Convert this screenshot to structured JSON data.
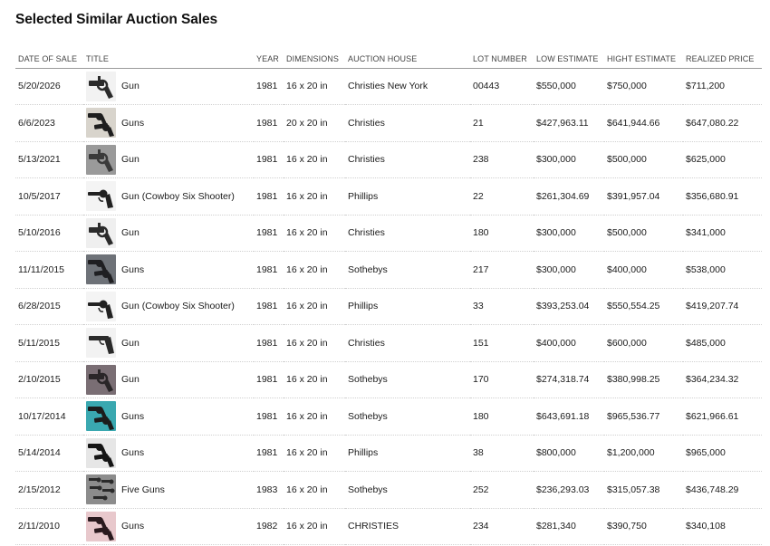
{
  "page": {
    "title": "Selected Similar Auction Sales"
  },
  "columns": {
    "date": "DATE OF SALE",
    "title": "TITLE",
    "year": "YEAR",
    "dimensions": "DIMENSIONS",
    "house": "AUCTION HOUSE",
    "lot": "LOT NUMBER",
    "low": "LOW ESTIMATE",
    "high": "HIGHT ESTIMATE",
    "realized": "REALIZED PRICE"
  },
  "rows": [
    {
      "date": "5/20/2026",
      "title": "Gun",
      "year": "1981",
      "dimensions": "16 x 20 in",
      "house": "Christies New York",
      "lot": "00443",
      "low": "$550,000",
      "high": "$750,000",
      "realized": "$711,200",
      "thumb": {
        "bg": "#f2f2f2",
        "fg": "#2b2b2b",
        "icon": "revolver-thumbnail-icon"
      }
    },
    {
      "date": "6/6/2023",
      "title": "Guns",
      "year": "1981",
      "dimensions": "20 x 20 in",
      "house": "Christies",
      "lot": "21",
      "low": "$427,963.11",
      "high": "$641,944.66",
      "realized": "$647,080.22",
      "thumb": {
        "bg": "#d8d4cc",
        "fg": "#1e1e1e",
        "icon": "revolvers-thumbnail-icon"
      }
    },
    {
      "date": "5/13/2021",
      "title": "Gun",
      "year": "1981",
      "dimensions": "16 x 20 in",
      "house": "Christies",
      "lot": "238",
      "low": "$300,000",
      "high": "$500,000",
      "realized": "$625,000",
      "thumb": {
        "bg": "#9a9a9a",
        "fg": "#3a3a3a",
        "icon": "revolver-thumbnail-icon"
      }
    },
    {
      "date": "10/5/2017",
      "title": "Gun (Cowboy Six Shooter)",
      "year": "1981",
      "dimensions": "16 x 20 in",
      "house": "Phillips",
      "lot": "22",
      "low": "$261,304.69",
      "high": "$391,957.04",
      "realized": "$356,680.91",
      "thumb": {
        "bg": "#f4f4f4",
        "fg": "#222222",
        "icon": "six-shooter-thumbnail-icon"
      }
    },
    {
      "date": "5/10/2016",
      "title": "Gun",
      "year": "1981",
      "dimensions": "16 x 20 in",
      "house": "Christies",
      "lot": "180",
      "low": "$300,000",
      "high": "$500,000",
      "realized": "$341,000",
      "thumb": {
        "bg": "#efefef",
        "fg": "#2a2a2a",
        "icon": "revolver-thumbnail-icon"
      }
    },
    {
      "date": "11/11/2015",
      "title": "Guns",
      "year": "1981",
      "dimensions": "16 x 20 in",
      "house": "Sothebys",
      "lot": "217",
      "low": "$300,000",
      "high": "$400,000",
      "realized": "$538,000",
      "thumb": {
        "bg": "#6e7278",
        "fg": "#1f1f22",
        "icon": "revolvers-thumbnail-icon"
      }
    },
    {
      "date": "6/28/2015",
      "title": "Gun (Cowboy Six Shooter)",
      "year": "1981",
      "dimensions": "16 x 20 in",
      "house": "Phillips",
      "lot": "33",
      "low": "$393,253.04",
      "high": "$550,554.25",
      "realized": "$419,207.74",
      "thumb": {
        "bg": "#f4f4f4",
        "fg": "#222222",
        "icon": "six-shooter-thumbnail-icon"
      }
    },
    {
      "date": "5/11/2015",
      "title": "Gun",
      "year": "1981",
      "dimensions": "16 x 20 in",
      "house": "Christies",
      "lot": "151",
      "low": "$400,000",
      "high": "$600,000",
      "realized": "$485,000",
      "thumb": {
        "bg": "#f2f2f2",
        "fg": "#2a2a2a",
        "icon": "pistol-thumbnail-icon"
      }
    },
    {
      "date": "2/10/2015",
      "title": "Gun",
      "year": "1981",
      "dimensions": "16 x 20 in",
      "house": "Sothebys",
      "lot": "170",
      "low": "$274,318.74",
      "high": "$380,998.25",
      "realized": "$364,234.32",
      "thumb": {
        "bg": "#7a6e74",
        "fg": "#2a2628",
        "icon": "revolver-thumbnail-icon"
      }
    },
    {
      "date": "10/17/2014",
      "title": "Guns",
      "year": "1981",
      "dimensions": "16 x 20 in",
      "house": "Sothebys",
      "lot": "180",
      "low": "$643,691.18",
      "high": "$965,536.77",
      "realized": "$621,966.61",
      "thumb": {
        "bg": "#3aa8b0",
        "fg": "#1c1c1c",
        "icon": "revolvers-thumbnail-icon"
      }
    },
    {
      "date": "5/14/2014",
      "title": "Guns",
      "year": "1981",
      "dimensions": "16 x 20 in",
      "house": "Phillips",
      "lot": "38",
      "low": "$800,000",
      "high": "$1,200,000",
      "realized": "$965,000",
      "thumb": {
        "bg": "#e6e6e6",
        "fg": "#151515",
        "icon": "revolvers-thumbnail-icon"
      }
    },
    {
      "date": "2/15/2012",
      "title": "Five Guns",
      "year": "1983",
      "dimensions": "16 x 20 in",
      "house": "Sothebys",
      "lot": "252",
      "low": "$236,293.03",
      "high": "$315,057.38",
      "realized": "$436,748.29",
      "thumb": {
        "bg": "#8c8c8c",
        "fg": "#2a2a2a",
        "icon": "five-guns-thumbnail-icon"
      }
    },
    {
      "date": "2/11/2010",
      "title": "Guns",
      "year": "1982",
      "dimensions": "16 x 20 in",
      "house": "CHRISTIES",
      "lot": "234",
      "low": "$281,340",
      "high": "$390,750",
      "realized": "$340,108",
      "thumb": {
        "bg": "#e8c8cc",
        "fg": "#2a1a1e",
        "icon": "revolvers-thumbnail-icon"
      }
    }
  ]
}
